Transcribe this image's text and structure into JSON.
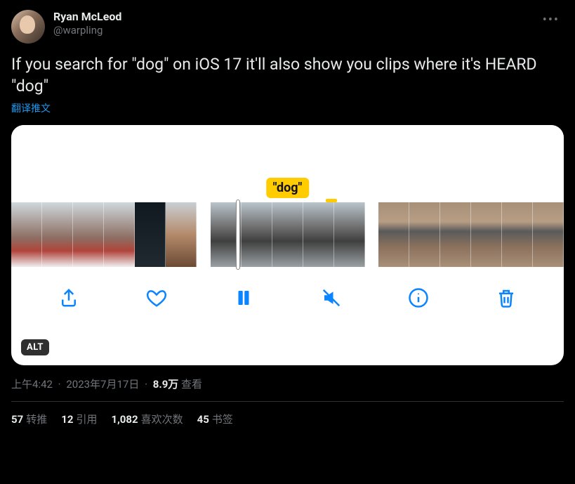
{
  "author": {
    "display_name": "Ryan McLeod",
    "handle": "@warpling"
  },
  "more_label": "•••",
  "body": "If you search for \"dog\" on iOS 17 it'll also show you clips where it's HEARD \"dog\"",
  "translate_label": "翻译推文",
  "media": {
    "caption_label": "\"dog\"",
    "alt_badge": "ALT",
    "toolbar": {
      "share": "分享",
      "like": "喜欢",
      "pause": "暂停",
      "mute": "静音",
      "info": "信息",
      "delete": "删除"
    }
  },
  "meta": {
    "time": "上午4:42",
    "date": "2023年7月17日",
    "views_num": "8.9万",
    "views_label": "查看"
  },
  "stats": {
    "retweets_num": "57",
    "retweets_label": "转推",
    "quotes_num": "12",
    "quotes_label": "引用",
    "likes_num": "1,082",
    "likes_label": "喜欢次数",
    "bookmarks_num": "45",
    "bookmarks_label": "书签"
  }
}
